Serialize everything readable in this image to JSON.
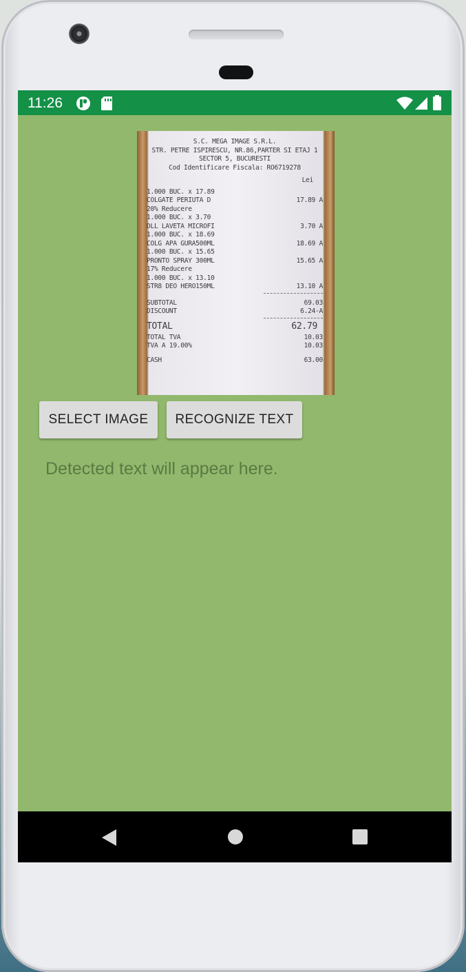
{
  "status_bar": {
    "time": "11:26",
    "left_icons": [
      "app-notification-icon",
      "sd-card-icon"
    ],
    "right_icons": [
      "wifi-icon",
      "cell-signal-icon",
      "battery-icon"
    ],
    "color": "#149047"
  },
  "receipt_image": {
    "header": [
      "S.C. MEGA IMAGE S.R.L.",
      "STR. PETRE ISPIRESCU, NR.86,PARTER SI ETAJ 1",
      "SECTOR 5, BUCURESTI",
      "Cod Identificare Fiscala: RO6719278"
    ],
    "currency": "Lei",
    "lines": [
      {
        "left": "  1.000  BUC. x 17.89",
        "right": ""
      },
      {
        "left": "COLGATE PERIUTA D",
        "right": "17.89 A"
      },
      {
        "left": "20% Reducere",
        "right": ""
      },
      {
        "left": "  1.000  BUC. x 3.70",
        "right": ""
      },
      {
        "left": "DLL LAVETA MICROFI",
        "right": "3.70 A"
      },
      {
        "left": "  1.000  BUC. x 18.69",
        "right": ""
      },
      {
        "left": "COLG APA GURA500ML",
        "right": "18.69 A"
      },
      {
        "left": "  1.000  BUC. x 15.65",
        "right": ""
      },
      {
        "left": "PRONTO SPRAY 300ML",
        "right": "15.65 A"
      },
      {
        "left": "17% Reducere",
        "right": ""
      },
      {
        "left": "  1.000  BUC. x 13.10",
        "right": ""
      },
      {
        "left": "STR8 DEO HERO150ML",
        "right": "13.10 A"
      }
    ],
    "subtotal_label": "SUBTOTAL",
    "subtotal_value": "69.03",
    "discount_label": "DISCOUNT",
    "discount_value": "6.24-A",
    "total_label": "TOTAL",
    "total_value": "62.79",
    "tva_total_label": "TOTAL TVA",
    "tva_total_value": "10.03",
    "tva_a_label": "TVA A   19.00%",
    "tva_a_value": "10.03",
    "cash_label": "CASH",
    "cash_value": "63.00"
  },
  "buttons": {
    "select_image": "SELECT IMAGE",
    "recognize_text": "RECOGNIZE TEXT"
  },
  "detected_text_placeholder": "Detected text will appear here.",
  "colors": {
    "screen_background": "#92b86d",
    "button_background": "#dcdcdc",
    "hint_text": "#5a7a43"
  },
  "navigation": {
    "icons": [
      "back-icon",
      "home-icon",
      "recent-apps-icon"
    ]
  }
}
